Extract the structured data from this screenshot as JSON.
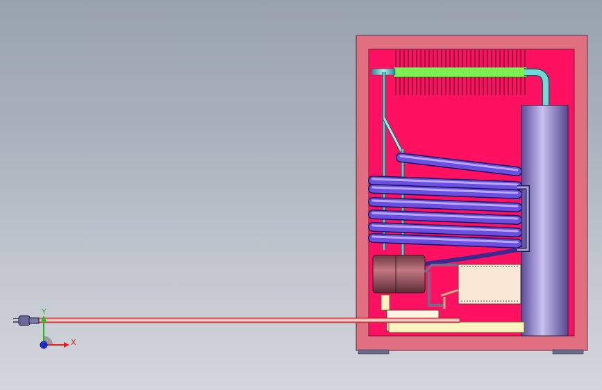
{
  "viewport": {
    "background_top": "#98a2ae",
    "background_bottom": "#d3d6dc"
  },
  "triad": {
    "x_label": "X",
    "y_label": "Y",
    "x_color": "#e02020",
    "y_color": "#20c020",
    "z_color": "#1a2ee0"
  },
  "model": {
    "cabinet_frame_color": "#e07080",
    "cabinet_interior_color": "#ff1060",
    "absorber_color": "#6a4fe0",
    "condenser_fin_color": "#7cf050",
    "boiler_color": "#8a6878",
    "reservoir_color": "#8878c8",
    "cable_color": "#d03030",
    "icons": [
      "power-plug-icon",
      "coordinate-triad-icon"
    ]
  }
}
